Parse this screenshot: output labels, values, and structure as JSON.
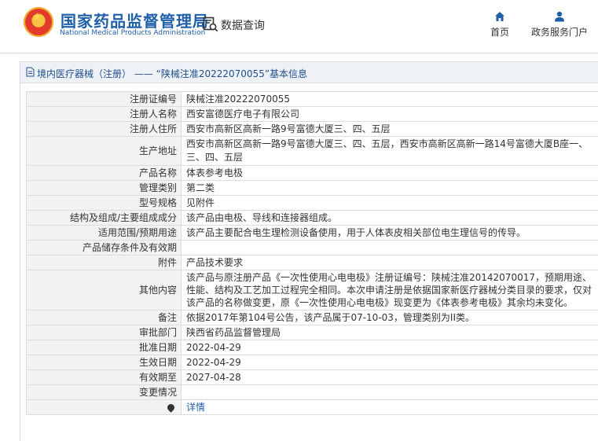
{
  "header": {
    "org_cn": "国家药品监督管理局",
    "org_en": "National Medical Products Administration",
    "search_label": "数据查询",
    "nav": [
      {
        "label": "首页",
        "icon": "home-icon"
      },
      {
        "label": "政务服务门户",
        "icon": "user-icon"
      }
    ]
  },
  "breadcrumb": "境内医疗器械（注册） —— “陕械注准20222070055”基本信息",
  "record": [
    {
      "key": "注册证编号",
      "value": "陕械注准20222070055"
    },
    {
      "key": "注册人名称",
      "value": "西安富德医疗电子有限公司"
    },
    {
      "key": "注册人住所",
      "value": "西安市高新区高新一路9号富德大厦三、四、五层"
    },
    {
      "key": "生产地址",
      "value": "西安市高新区高新一路9号富德大厦三、四、五层，西安市高新区高新一路14号富德大厦B座一、三、四、五层"
    },
    {
      "key": "产品名称",
      "value": "体表参考电极"
    },
    {
      "key": "管理类别",
      "value": "第二类"
    },
    {
      "key": "型号规格",
      "value": "见附件"
    },
    {
      "key": "结构及组成/主要组成成分",
      "value": "该产品由电极、导线和连接器组成。"
    },
    {
      "key": "适用范围/预期用途",
      "value": "该产品主要配合电生理检测设备使用，用于人体表皮相关部位电生理信号的传导。"
    },
    {
      "key": "产品储存条件及有效期",
      "value": ""
    },
    {
      "key": "附件",
      "value": "产品技术要求"
    },
    {
      "key": "其他内容",
      "value": "该产品与原注册产品《一次性使用心电电极》注册证编号：陕械注准20142070017，预期用途、性能、结构及工艺加工过程完全相同。本次申请注册是依据国家新医疗器械分类目录的要求，仅对该产品的名称做变更，原《一次性使用心电电极》现变更为《体表参考电极》其余均未变化。"
    },
    {
      "key": "备注",
      "value": "依据2017年第104号公告，该产品属于07-10-03，管理类别为II类。"
    },
    {
      "key": "审批部门",
      "value": "陕西省药品监督管理局"
    },
    {
      "key": "批准日期",
      "value": "2022-04-29"
    },
    {
      "key": "生效日期",
      "value": "2022-04-29"
    },
    {
      "key": "有效期至",
      "value": "2027-04-28"
    },
    {
      "key": "变更情况",
      "value": ""
    }
  ],
  "footer_row": {
    "key": "",
    "link_label": "详情"
  }
}
